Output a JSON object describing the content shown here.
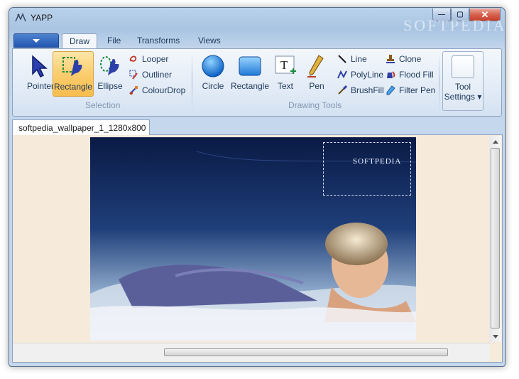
{
  "window": {
    "title": "YAPP",
    "watermark_text": "SOFTPEDIA"
  },
  "titlebar": {
    "min_glyph": "—",
    "max_glyph": "▢",
    "close_glyph": "✕"
  },
  "ribbon_tabs": [
    "Draw",
    "File",
    "Transforms",
    "Views"
  ],
  "selection_group": {
    "label": "Selection",
    "big_buttons": [
      {
        "label": "Pointer",
        "icon": "pointer-arrow-icon"
      },
      {
        "label": "Rectangle",
        "icon": "rectangle-select-icon",
        "selected": true
      },
      {
        "label": "Ellipse",
        "icon": "ellipse-select-icon"
      }
    ],
    "small_buttons": [
      {
        "label": "Looper",
        "icon": "looper-icon"
      },
      {
        "label": "Outliner",
        "icon": "outliner-icon"
      },
      {
        "label": "ColourDrop",
        "icon": "colourdrop-icon"
      }
    ]
  },
  "drawing_group": {
    "label": "Drawing Tools",
    "big_buttons": [
      {
        "label": "Circle",
        "icon": "circle-icon"
      },
      {
        "label": "Rectangle",
        "icon": "rectangle-icon"
      },
      {
        "label": "Text",
        "icon": "text-icon"
      },
      {
        "label": "Pen",
        "icon": "pen-icon"
      }
    ],
    "small_buttons_col1": [
      {
        "label": "Line",
        "icon": "line-icon"
      },
      {
        "label": "PolyLine",
        "icon": "polyline-icon"
      },
      {
        "label": "BrushFill",
        "icon": "brushfill-icon"
      }
    ],
    "small_buttons_col2": [
      {
        "label": "Clone",
        "icon": "clone-stamp-icon"
      },
      {
        "label": "Flood Fill",
        "icon": "flood-fill-icon"
      },
      {
        "label": "Filter Pen",
        "icon": "filter-pen-icon"
      }
    ]
  },
  "tool_settings": {
    "line1": "Tool",
    "line2": "Settings ▾"
  },
  "document": {
    "tab_label": "softpedia_wallpaper_1_1280x800",
    "image_text": "SOFTPEDIA"
  },
  "colors": {
    "canvas_bg": "#f6eadb",
    "ribbon_bg": "#dfe9f5",
    "selected": "#fbcf72",
    "image_sky": "#0f2150"
  }
}
